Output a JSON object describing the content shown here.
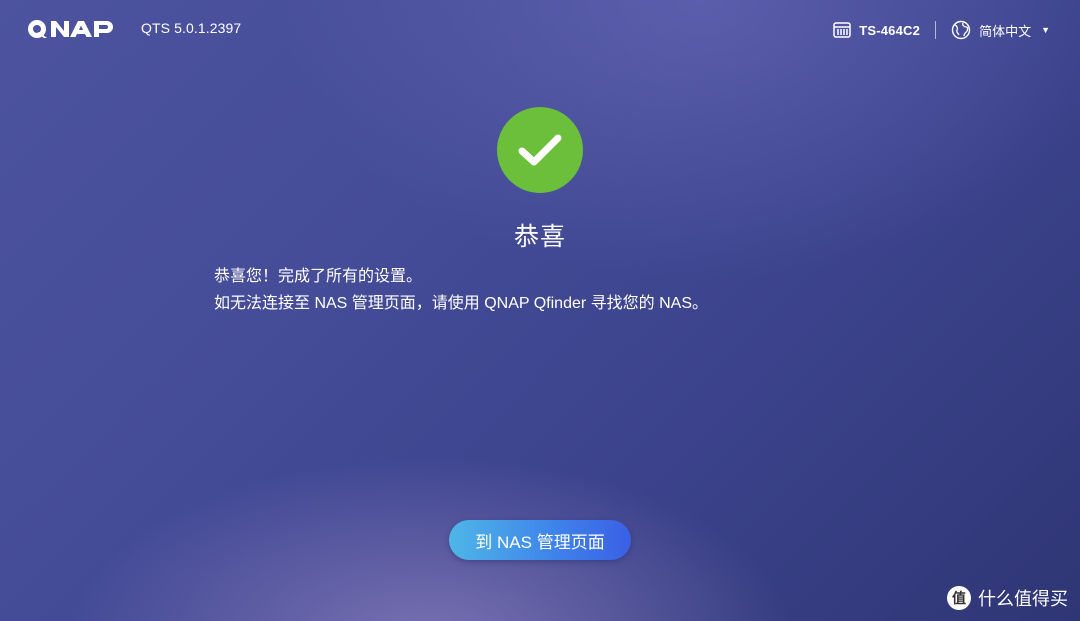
{
  "header": {
    "brand": "QNAP",
    "version": "QTS 5.0.1.2397",
    "device_name": "TS-464C2",
    "device_icon": "nas-device-icon",
    "language": "简体中文",
    "language_icon": "globe-icon",
    "language_caret_icon": "caret-down-icon"
  },
  "main": {
    "status_icon": "checkmark-icon",
    "title": "恭喜",
    "message_line1": "恭喜您！完成了所有的设置。",
    "message_line2": "如无法连接至 NAS 管理页面，请使用 QNAP Qfinder 寻找您的 NAS。",
    "button_label": "到 NAS 管理页面"
  },
  "watermark": {
    "badge": "值",
    "text": "什么值得买"
  },
  "colors": {
    "success": "#6bbf3a",
    "button_start": "#4fb6e6",
    "button_end": "#3a5fe6",
    "background": "#454c98"
  }
}
